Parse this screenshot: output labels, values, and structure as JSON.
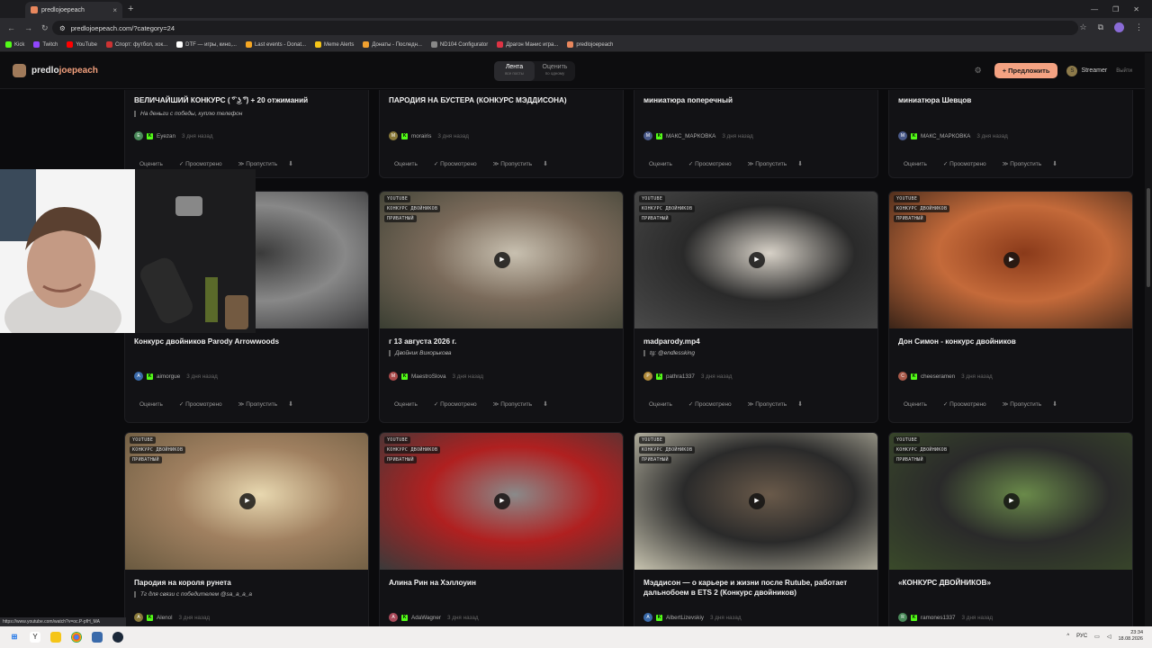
{
  "browser": {
    "tab_title": "predlojoepeach",
    "tab_close": "×",
    "new_tab": "+",
    "url": "predlojoepeach.com/?category=24",
    "bookmarks": [
      {
        "label": "Kick",
        "color": "#53fc18"
      },
      {
        "label": "Twitch",
        "color": "#9146ff"
      },
      {
        "label": "YouTube",
        "color": "#ff0000"
      },
      {
        "label": "Спорт: футбол, хок...",
        "color": "#cc3333"
      },
      {
        "label": "DTF — игры, кино,...",
        "color": "#ffffff"
      },
      {
        "label": "Last events - Donat...",
        "color": "#f5a623"
      },
      {
        "label": "Meme Alerts",
        "color": "#f5c518"
      },
      {
        "label": "Донаты - Последн...",
        "color": "#f0a030"
      },
      {
        "label": "ND104 Configurator",
        "color": "#888888"
      },
      {
        "label": "Драгон Манис игра...",
        "color": "#d34"
      },
      {
        "label": "predlojoepeach",
        "color": "#e8875d"
      }
    ],
    "status_url": "https://www.youtube.com/watch?v=oc.P-pfH_MA"
  },
  "site": {
    "logo_a": "predlo",
    "logo_b": "joepeach",
    "nav": [
      {
        "label": "Лента",
        "sub": "все посты"
      },
      {
        "label": "Оценить",
        "sub": "по одному"
      }
    ],
    "suggest_button": "+ Предложить",
    "user_initial": "S",
    "user_name": "Streamer",
    "logout": "Выйти"
  },
  "actions": {
    "rate": "Оценить",
    "viewed": "✓ Просмотрено",
    "skip": "≫ Пропустить",
    "pin": "⬇"
  },
  "badges": {
    "youtube": "YOUTUBE",
    "contest": "КОНКУРС ДВОЙНИКОВ",
    "private": "ПРИВАТНЫЙ"
  },
  "top_row": [
    {
      "title": "ВЕЛИЧАЙШИЙ КОНКУРС ( ͡° ͜ʖ ͡°) + 20 отжиманий",
      "note": "На деньги с победы, куплю телефон",
      "initial": "E",
      "author": "Eyezan",
      "ago": "3 дня назад",
      "av_color": "#4a8a5a"
    },
    {
      "title": "ПАРОДИЯ НА БУСТЕРА (КОНКУРС МЭДДИСОНА)",
      "note": "",
      "initial": "M",
      "author": "morairis",
      "ago": "3 дня назад",
      "av_color": "#8a7a3a"
    },
    {
      "title": "миниатюра поперечный",
      "note": "",
      "initial": "M",
      "author": "МАКС_МАРКОВКА",
      "ago": "3 дня назад",
      "av_color": "#4a5a8a"
    },
    {
      "title": "миниатюра Шевцов",
      "note": "",
      "initial": "M",
      "author": "МАКС_МАРКОВКА",
      "ago": "3 дня назад",
      "av_color": "#4a5a8a"
    }
  ],
  "mid_row": [
    {
      "title": "Конкурс двойников Parody Arrowwoods",
      "note": "",
      "initial": "A",
      "author": "aimorgue",
      "ago": "3 дня назад",
      "av_color": "#3a6aaa"
    },
    {
      "title": "г 13 августа 2026 г.",
      "note": "Двойник Вихорькова",
      "initial": "M",
      "author": "MaestroSlova",
      "ago": "3 дня назад",
      "av_color": "#aa4a4a"
    },
    {
      "title": "madparody.mp4",
      "note": "tg: @endlessking",
      "initial": "P",
      "author": "pathra1337",
      "ago": "3 дня назад",
      "av_color": "#b08a3a"
    },
    {
      "title": "Дон Симон - конкурс двойников",
      "note": "",
      "initial": "C",
      "author": "cheeseramen",
      "ago": "3 дня назад",
      "av_color": "#aa5a4a"
    }
  ],
  "bottom_row": [
    {
      "title": "Пародия на короля рунета",
      "note": "Тг для связи с победителем @sa_a_a_a",
      "initial": "A",
      "author": "Alenol",
      "ago": "3 дня назад",
      "av_color": "#8a7a3a"
    },
    {
      "title": "Алина Рин на Хэллоуин",
      "note": "",
      "initial": "A",
      "author": "AdaWagner",
      "ago": "3 дня назад",
      "av_color": "#aa4a5a"
    },
    {
      "title": "Мэддисон — о карьере и жизни после Rutube, работает дальнобоем в ETS 2 (Конкурс двойников)",
      "note": "",
      "initial": "A",
      "author": "AlbertLizevskiy",
      "ago": "3 дня назад",
      "av_color": "#3a6aaa"
    },
    {
      "title": "«КОНКУРС ДВОЙНИКОВ»",
      "note": "",
      "initial": "R",
      "author": "ramones1337",
      "ago": "3 дня назад",
      "av_color": "#4a8a5a"
    }
  ],
  "taskbar": {
    "lang": "РУС",
    "time": "23:34",
    "date": "18.08.2026"
  }
}
